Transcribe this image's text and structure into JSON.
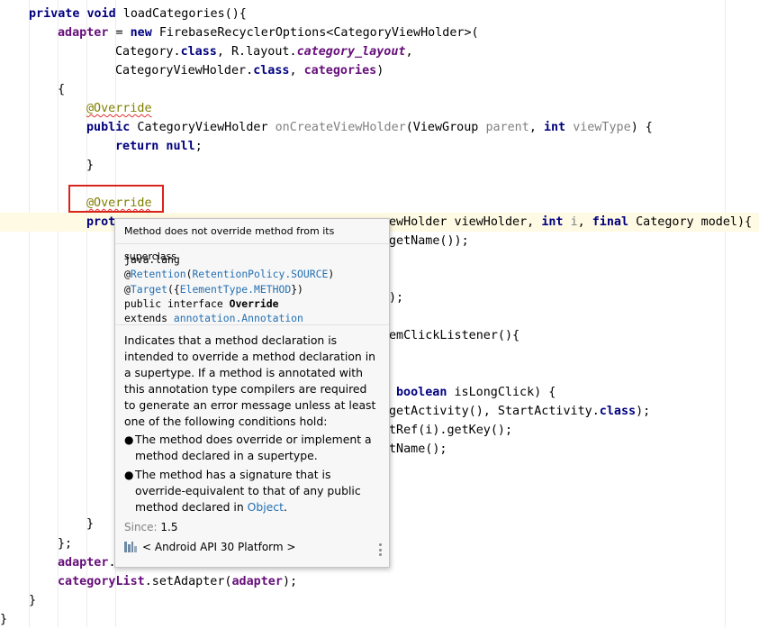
{
  "code": {
    "l1": {
      "kw": "private void",
      "rest": " loadCategories(){"
    },
    "l2": {
      "fld": "adapter",
      "eq": " = ",
      "kw": "new",
      "rest": " FirebaseRecyclerOptions<CategoryViewHolder>("
    },
    "l3": {
      "a": "Category.",
      "kw": "class",
      "b": ", R.layout.",
      "fldi": "category_layout",
      "c": ","
    },
    "l4": {
      "a": "CategoryViewHolder.",
      "kw": "class",
      "b": ", ",
      "fld": "categories",
      "c": ")"
    },
    "l5": {
      "text": "{"
    },
    "l6": {
      "ann": "@Override"
    },
    "l7": {
      "kw": "public",
      "a": " CategoryViewHolder ",
      "meth": "onCreateViewHolder",
      "b": "(ViewGroup ",
      "p1": "parent",
      "c": ", ",
      "kw2": "int",
      "d": " ",
      "p2": "viewType",
      "e": ") {"
    },
    "l8": {
      "kw": "return null",
      "rest": ";"
    },
    "l9": {
      "text": "}"
    },
    "l10": {
      "ann": "@Override"
    },
    "l11": {
      "kw": "prot"
    },
    "l11r": {
      "a": "ewHolder viewHolder, ",
      "kw": "int",
      "b": " ",
      "p": "i",
      "c": ", ",
      "kw2": "final",
      "d": " Category model){"
    },
    "l12r": {
      "text": "getName());"
    },
    "l13r": {
      "text": ");"
    },
    "l14r": {
      "text": "emClickListener(){"
    },
    "l15r": {
      "kw": "boolean",
      "rest": " isLongClick) {"
    },
    "l16r": {
      "a": "getActivity(), StartActivity.",
      "kw": "class",
      "b": ");"
    },
    "l17r": {
      "text": "tRef(i).getKey();"
    },
    "l18r": {
      "text": "tName();"
    },
    "l19": {
      "text": "}"
    },
    "l20": {
      "text": "};"
    },
    "l21": {
      "fld": "adapter",
      "rest": "."
    },
    "l22": {
      "fld": "categoryList",
      "a": ".setAdapter(",
      "fld2": "adapter",
      "b": ");"
    },
    "l23": {
      "text": "}"
    },
    "l24": {
      "text": "}"
    }
  },
  "popup": {
    "header": "Method does not override method from its superclass",
    "defn": {
      "pkg": "java.lang",
      "r_at": "@",
      "r_name": "Retention",
      "r_open": "(",
      "r_arg": "RetentionPolicy.SOURCE",
      "r_close": ")",
      "t_at": "@",
      "t_name": "Target",
      "t_open": "({",
      "t_arg": "ElementType.METHOD",
      "t_close": "})",
      "decl": "public interface ",
      "decl_name": "Override",
      "ext": "extends ",
      "ext_name": "annotation.Annotation"
    },
    "description": "Indicates that a method declaration is intended to override a method declaration in a supertype. If a method is annotated with this annotation type compilers are required to generate an error message unless at least one of the following conditions hold:",
    "bullet1": "The method does override or implement a method declared in a supertype.",
    "bullet2_text": "The method has a signature that is override-equivalent to that of any public method declared in ",
    "bullet2_link": "Object",
    "bullet2_end": ".",
    "bullet_glyph": "●",
    "since_label": "Since:",
    "since_value": "1.5",
    "platform": "< Android API 30 Platform >",
    "more_icon": "kebab-menu-icon",
    "platform_icon": "library-icon"
  }
}
